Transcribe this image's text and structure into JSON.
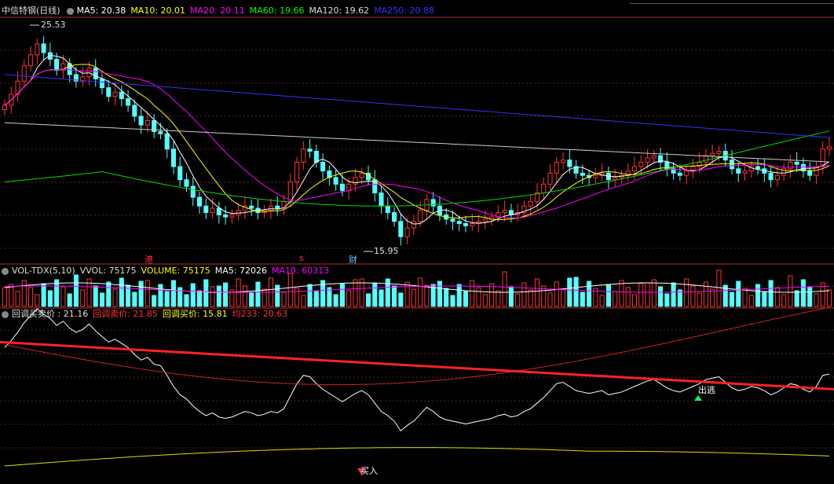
{
  "title": "中信特钢(日线)",
  "ma_header": [
    {
      "label": "MA5: 20.38",
      "color": "#ffffff"
    },
    {
      "label": "MA10: 20.01",
      "color": "#ffff00"
    },
    {
      "label": "MA20: 20.11",
      "color": "#ff00ff"
    },
    {
      "label": "MA60: 19.66",
      "color": "#00ff00"
    },
    {
      "label": "MA120: 19.62",
      "color": "#dddddd"
    },
    {
      "label": "MA250: 20.88",
      "color": "#3030ff"
    }
  ],
  "vol_header": [
    {
      "label": "VOL-TDX(5,10)",
      "color": "#dddddd"
    },
    {
      "label": "VVOL: 75175",
      "color": "#dddddd"
    },
    {
      "label": "VOLUME: 75175",
      "color": "#ffff00"
    },
    {
      "label": "MA5: 72026",
      "color": "#ffffff"
    },
    {
      "label": "MA10: 60313",
      "color": "#ff00ff"
    }
  ],
  "ind_header": [
    {
      "label": "回调买卖价 : 21.16",
      "color": "#dddddd"
    },
    {
      "label": "回调卖价: 21.85",
      "color": "#ff3333"
    },
    {
      "label": "回调买价: 15.81",
      "color": "#ffff00"
    },
    {
      "label": "均233: 20.63",
      "color": "#ff3333"
    }
  ],
  "annotations": {
    "high": "25.53",
    "low": "15.95",
    "mark_gang": "港",
    "mark_s": "s",
    "mark_cai": "财",
    "sell_signal": "出逃",
    "buy_signal": "买入"
  },
  "chart_data": {
    "type": "candlestick",
    "title": "中信特钢(日线)",
    "price_range": [
      15.95,
      25.53
    ],
    "moving_averages": {
      "MA5": 20.38,
      "MA10": 20.01,
      "MA20": 20.11,
      "MA60": 19.66,
      "MA120": 19.62,
      "MA250": 20.88
    },
    "volume": {
      "VVOL": 75175,
      "VOLUME": 75175,
      "MA5": 72026,
      "MA10": 60313
    },
    "indicator": {
      "回调买卖价": 21.16,
      "回调卖价": 21.85,
      "回调买价": 15.81,
      "均233": 20.63
    },
    "close": [
      22.2,
      22.7,
      23.3,
      24.0,
      24.5,
      25.0,
      24.6,
      24.3,
      23.8,
      24.1,
      23.6,
      23.3,
      23.5,
      23.9,
      23.4,
      23.0,
      22.6,
      22.8,
      22.5,
      22.2,
      21.7,
      21.3,
      21.5,
      21.0,
      20.9,
      20.2,
      19.4,
      18.8,
      18.5,
      18.0,
      17.6,
      17.3,
      17.5,
      17.2,
      17.1,
      17.2,
      17.4,
      17.6,
      17.5,
      17.3,
      17.4,
      17.6,
      17.5,
      17.8,
      18.7,
      19.6,
      20.2,
      20.1,
      19.6,
      19.2,
      18.9,
      18.6,
      18.3,
      18.6,
      18.9,
      19.1,
      18.8,
      18.2,
      17.6,
      17.3,
      16.9,
      16.2,
      16.6,
      16.9,
      17.4,
      17.9,
      17.6,
      17.2,
      17.0,
      16.9,
      16.8,
      16.7,
      16.8,
      16.9,
      17.0,
      17.1,
      17.3,
      17.4,
      17.2,
      17.3,
      17.6,
      17.8,
      18.2,
      18.6,
      19.1,
      19.6,
      19.7,
      19.4,
      19.1,
      19.0,
      18.9,
      19.0,
      19.1,
      18.8,
      18.9,
      19.0,
      19.2,
      19.4,
      19.6,
      19.8,
      19.9,
      19.6,
      19.3,
      19.1,
      19.0,
      19.2,
      19.4,
      19.6,
      19.9,
      20.0,
      20.1,
      19.7,
      19.3,
      19.1,
      19.2,
      19.4,
      19.3,
      19.1,
      18.8,
      19.0,
      19.3,
      19.6,
      19.5,
      19.2,
      19.0,
      19.4,
      20.2,
      20.3
    ]
  }
}
